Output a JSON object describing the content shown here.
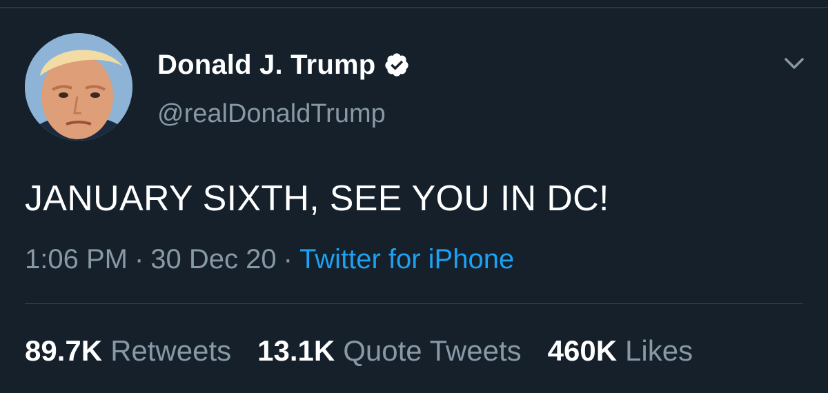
{
  "tweet": {
    "author": {
      "display_name": "Donald J. Trump",
      "handle": "@realDonaldTrump",
      "verified": true
    },
    "text": "JANUARY SIXTH, SEE YOU IN DC!",
    "time": "1:06 PM",
    "separator": "·",
    "date": "30 Dec 20",
    "source": "Twitter for iPhone",
    "stats": [
      {
        "count": "89.7K",
        "label": "Retweets"
      },
      {
        "count": "13.1K",
        "label": "Quote Tweets"
      },
      {
        "count": "460K",
        "label": "Likes"
      }
    ]
  },
  "icons": {
    "verified": "verified-badge-icon",
    "more": "chevron-down-icon"
  },
  "colors": {
    "background": "#15202b",
    "primary_text": "#ffffff",
    "secondary_text": "#8899a6",
    "link": "#1da1f2",
    "divider": "#38444d"
  }
}
